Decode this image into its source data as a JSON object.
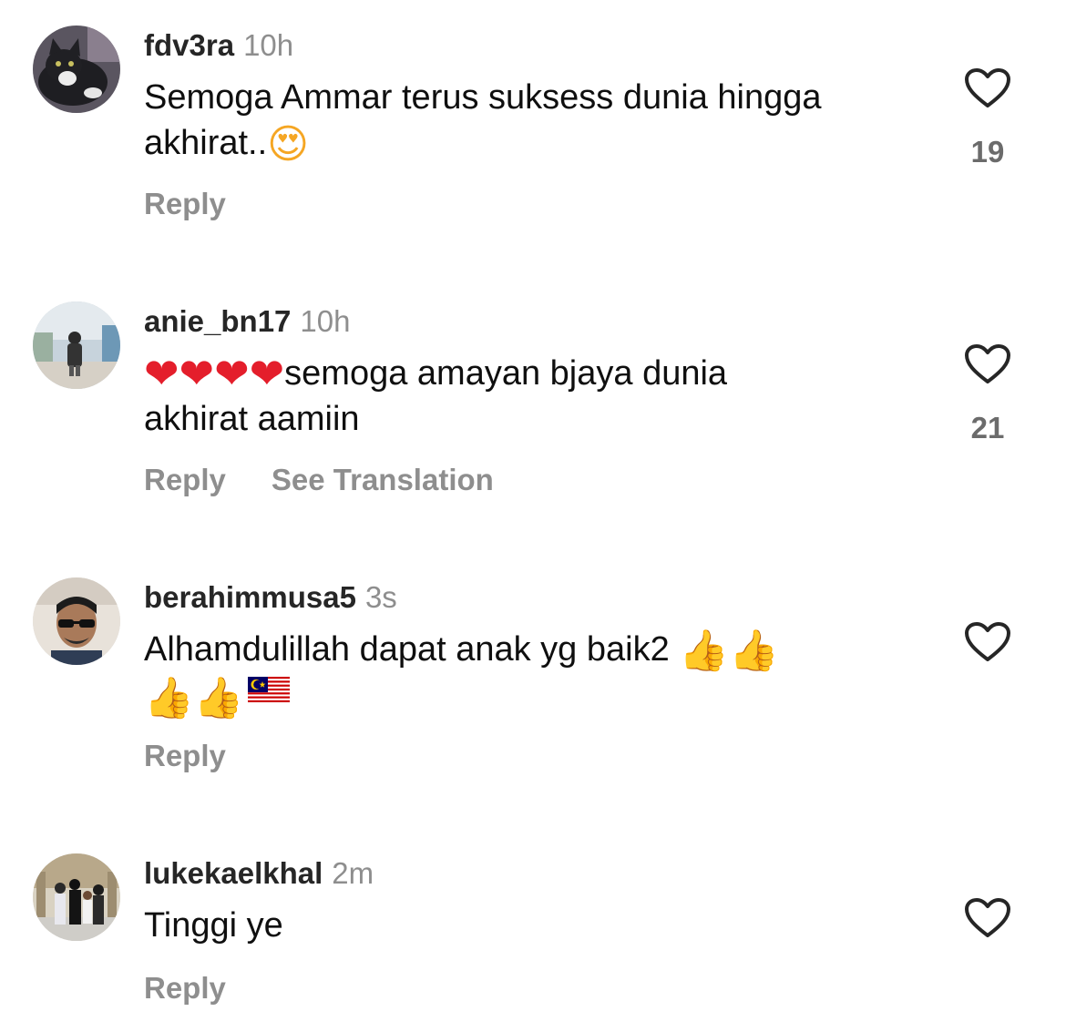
{
  "comments": [
    {
      "username": "fdv3ra",
      "time": "10h",
      "text_line1": "Semoga Ammar terus suksess dunia hingga",
      "text_line2": "akhirat..",
      "emoji_face": "😍",
      "reply": "Reply",
      "likes": "19",
      "avatar_icon": "cat-avatar-icon"
    },
    {
      "username": "anie_bn17",
      "time": "10h",
      "emoji_hearts": "❤❤❤❤",
      "text_line1": "semoga amayan bjaya dunia",
      "text_line2": "akhirat aamiin",
      "reply": "Reply",
      "see_translation": "See Translation",
      "likes": "21",
      "avatar_icon": "person-outdoor-avatar-icon"
    },
    {
      "username": "berahimmusa5",
      "time": "3s",
      "text_line1": "Alhamdulillah dapat anak yg baik2",
      "emoji_thumbs_line1": "👍👍",
      "emoji_thumbs_line2": "👍👍",
      "reply": "Reply",
      "avatar_icon": "man-sunglasses-avatar-icon"
    },
    {
      "username": "lukekaelkhal",
      "time": "2m",
      "text_line1": "Tinggi ye",
      "reply": "Reply",
      "avatar_icon": "family-group-avatar-icon"
    }
  ],
  "colors": {
    "username": "#262626",
    "meta_gray": "#8e8e8e",
    "heart_outline": "#262626"
  }
}
